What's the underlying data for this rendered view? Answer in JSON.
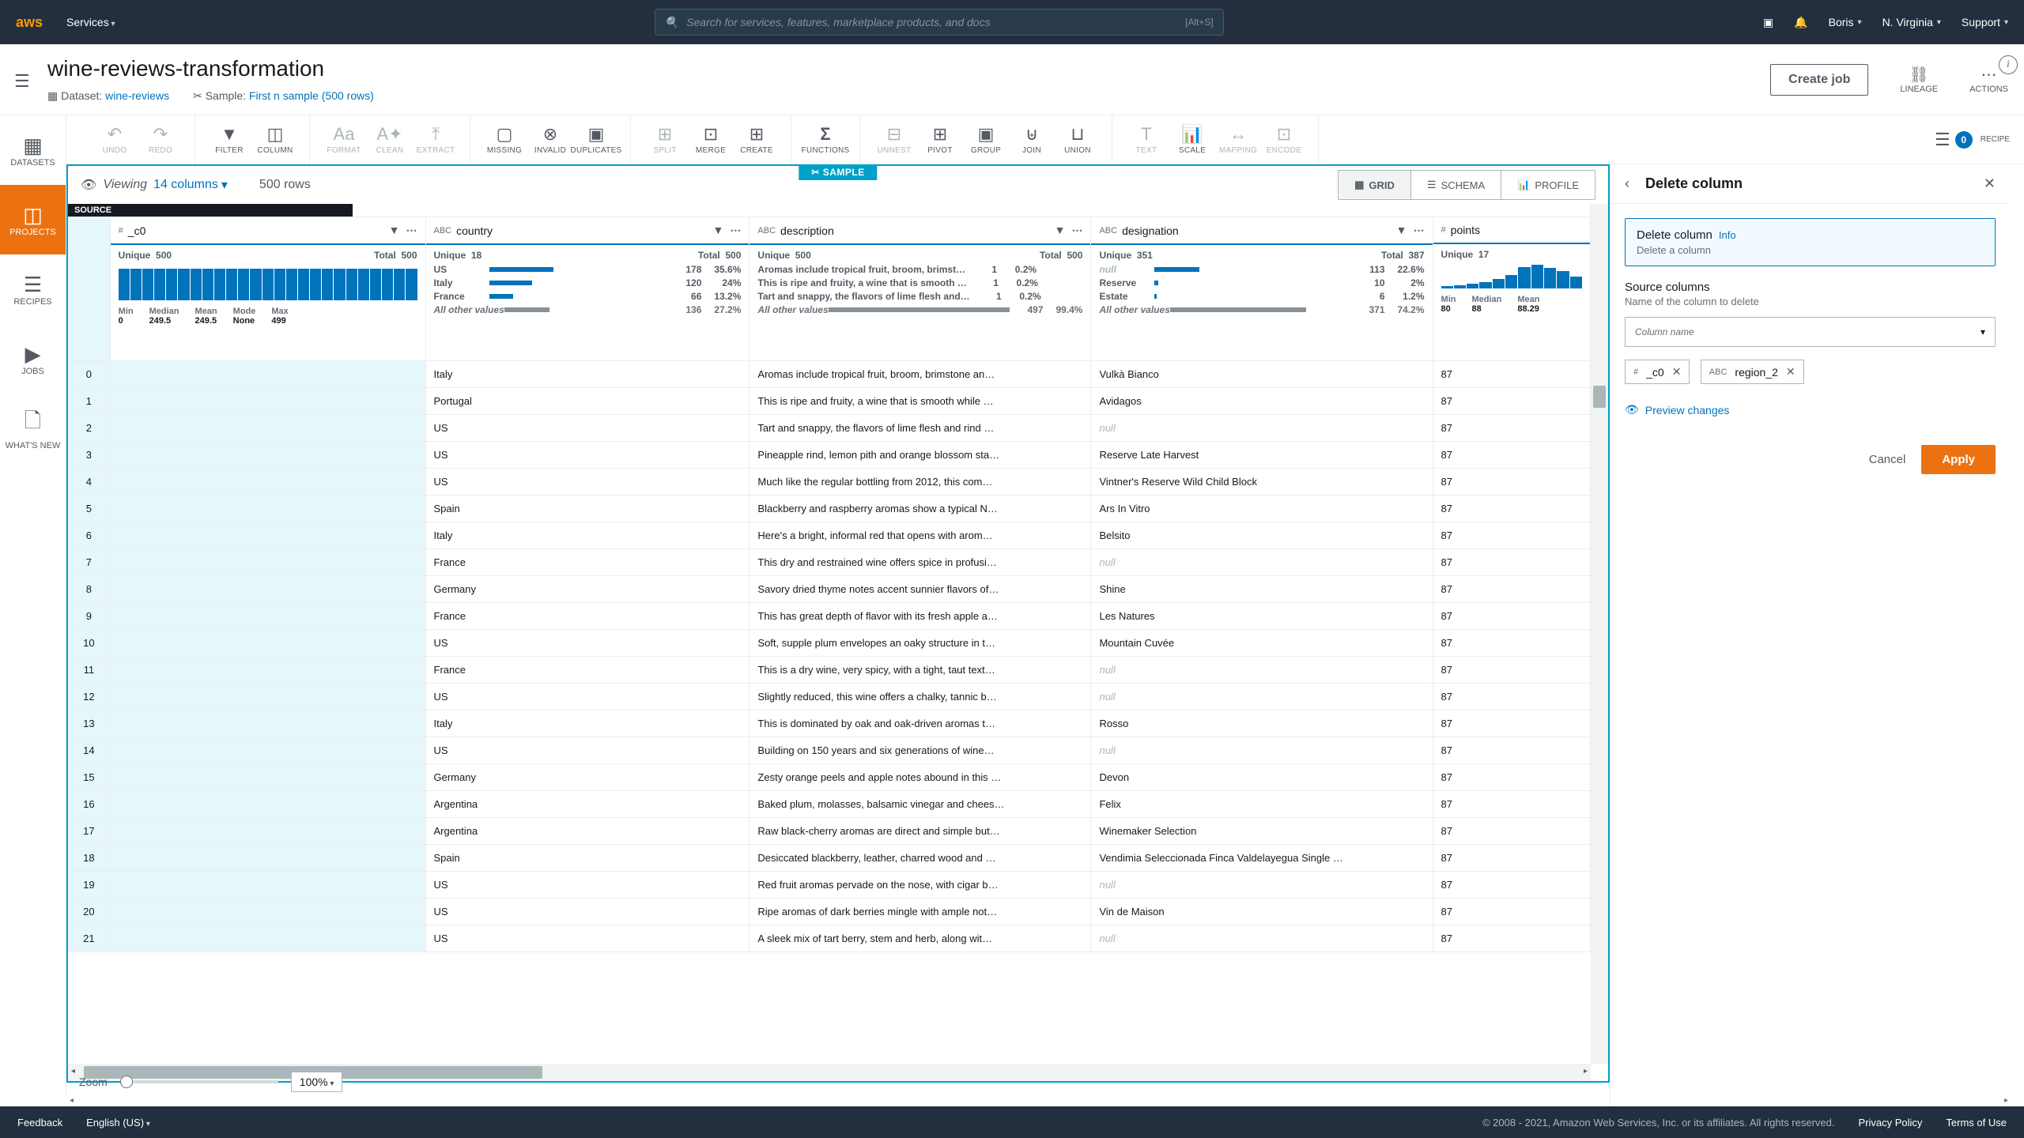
{
  "aws_bar": {
    "services": "Services",
    "search_placeholder": "Search for services, features, marketplace products, and docs",
    "search_kbd": "[Alt+S]",
    "user": "Boris",
    "region": "N. Virginia",
    "support": "Support"
  },
  "titlebar": {
    "title": "wine-reviews-transformation",
    "dataset_label": "Dataset:",
    "dataset_link": "wine-reviews",
    "sample_label": "Sample:",
    "sample_link": "First n sample (500 rows)",
    "create_job": "Create job",
    "lineage": "LINEAGE",
    "actions": "ACTIONS"
  },
  "sidebar": {
    "items": [
      "DATASETS",
      "PROJECTS",
      "RECIPES",
      "JOBS",
      "WHAT'S NEW"
    ]
  },
  "toolbar": {
    "undo": "UNDO",
    "redo": "REDO",
    "filter": "FILTER",
    "column": "COLUMN",
    "format": "FORMAT",
    "clean": "CLEAN",
    "extract": "EXTRACT",
    "missing": "MISSING",
    "invalid": "INVALID",
    "duplicates": "DUPLICATES",
    "split": "SPLIT",
    "merge": "MERGE",
    "create": "CREATE",
    "functions": "FUNCTIONS",
    "unnest": "UNNEST",
    "pivot": "PIVOT",
    "group": "GROUP",
    "join": "JOIN",
    "union": "UNION",
    "text": "TEXT",
    "scale": "SCALE",
    "mapping": "MAPPING",
    "encode": "ENCODE",
    "recipe": "RECIPE",
    "recipe_count": "0"
  },
  "view_header": {
    "viewing": "Viewing",
    "columns": "14 columns",
    "rows": "500 rows",
    "sample": "SAMPLE",
    "tab_grid": "GRID",
    "tab_schema": "SCHEMA",
    "tab_profile": "PROFILE"
  },
  "columns": {
    "idx_source": "SOURCE",
    "c0": {
      "type": "#",
      "name": "_c0",
      "unique_l": "Unique",
      "unique": "500",
      "total_l": "Total",
      "total": "500",
      "min_l": "Min",
      "min": "0",
      "median_l": "Median",
      "median": "249.5",
      "mean_l": "Mean",
      "mean": "249.5",
      "mode_l": "Mode",
      "mode": "None",
      "max_l": "Max",
      "max": "499"
    },
    "country": {
      "type": "ABC",
      "name": "country",
      "unique_l": "Unique",
      "unique": "18",
      "total_l": "Total",
      "total": "500",
      "d1": {
        "l": "US",
        "n": "178",
        "p": "35.6%"
      },
      "d2": {
        "l": "Italy",
        "n": "120",
        "p": "24%"
      },
      "d3": {
        "l": "France",
        "n": "66",
        "p": "13.2%"
      },
      "other": {
        "l": "All other values",
        "n": "136",
        "p": "27.2%"
      }
    },
    "description": {
      "type": "ABC",
      "name": "description",
      "unique_l": "Unique",
      "unique": "500",
      "total_l": "Total",
      "total": "500",
      "d1": {
        "l": "Aromas include tropical fruit, broom, brimst…",
        "n": "1",
        "p": "0.2%"
      },
      "d2": {
        "l": "This is ripe and fruity, a wine that is smooth …",
        "n": "1",
        "p": "0.2%"
      },
      "d3": {
        "l": "Tart and snappy, the flavors of lime flesh and…",
        "n": "1",
        "p": "0.2%"
      },
      "other": {
        "l": "All other values",
        "n": "497",
        "p": "99.4%"
      }
    },
    "designation": {
      "type": "ABC",
      "name": "designation",
      "unique_l": "Unique",
      "unique": "351",
      "total_l": "Total",
      "total": "387",
      "d1": {
        "l": "null",
        "n": "113",
        "p": "22.6%"
      },
      "d2": {
        "l": "Reserve",
        "n": "10",
        "p": "2%"
      },
      "d3": {
        "l": "Estate",
        "n": "6",
        "p": "1.2%"
      },
      "other": {
        "l": "All other values",
        "n": "371",
        "p": "74.2%"
      }
    },
    "points": {
      "type": "#",
      "name": "points",
      "unique_l": "Unique",
      "unique": "17",
      "min_l": "Min",
      "min": "80",
      "median_l": "Median",
      "median": "88",
      "mean_l": "Mean",
      "mean": "88.29"
    }
  },
  "rows": [
    {
      "i": "0",
      "country": "Italy",
      "desc": "Aromas include tropical fruit, broom, brimstone an…",
      "desig": "Vulkà Bianco",
      "pts": "87"
    },
    {
      "i": "1",
      "country": "Portugal",
      "desc": "This is ripe and fruity, a wine that is smooth while …",
      "desig": "Avidagos",
      "pts": "87"
    },
    {
      "i": "2",
      "country": "US",
      "desc": "Tart and snappy, the flavors of lime flesh and rind …",
      "desig": "null",
      "pts": "87"
    },
    {
      "i": "3",
      "country": "US",
      "desc": "Pineapple rind, lemon pith and orange blossom sta…",
      "desig": "Reserve Late Harvest",
      "pts": "87"
    },
    {
      "i": "4",
      "country": "US",
      "desc": "Much like the regular bottling from 2012, this com…",
      "desig": "Vintner's Reserve Wild Child Block",
      "pts": "87"
    },
    {
      "i": "5",
      "country": "Spain",
      "desc": "Blackberry and raspberry aromas show a typical N…",
      "desig": "Ars In Vitro",
      "pts": "87"
    },
    {
      "i": "6",
      "country": "Italy",
      "desc": "Here's a bright, informal red that opens with arom…",
      "desig": "Belsito",
      "pts": "87"
    },
    {
      "i": "7",
      "country": "France",
      "desc": "This dry and restrained wine offers spice in profusi…",
      "desig": "null",
      "pts": "87"
    },
    {
      "i": "8",
      "country": "Germany",
      "desc": "Savory dried thyme notes accent sunnier flavors of…",
      "desig": "Shine",
      "pts": "87"
    },
    {
      "i": "9",
      "country": "France",
      "desc": "This has great depth of flavor with its fresh apple a…",
      "desig": "Les Natures",
      "pts": "87"
    },
    {
      "i": "10",
      "country": "US",
      "desc": "Soft, supple plum envelopes an oaky structure in t…",
      "desig": "Mountain Cuvée",
      "pts": "87"
    },
    {
      "i": "11",
      "country": "France",
      "desc": "This is a dry wine, very spicy, with a tight, taut text…",
      "desig": "null",
      "pts": "87"
    },
    {
      "i": "12",
      "country": "US",
      "desc": "Slightly reduced, this wine offers a chalky, tannic b…",
      "desig": "null",
      "pts": "87"
    },
    {
      "i": "13",
      "country": "Italy",
      "desc": "This is dominated by oak and oak-driven aromas t…",
      "desig": "Rosso",
      "pts": "87"
    },
    {
      "i": "14",
      "country": "US",
      "desc": "Building on 150 years and six generations of wine…",
      "desig": "null",
      "pts": "87"
    },
    {
      "i": "15",
      "country": "Germany",
      "desc": "Zesty orange peels and apple notes abound in this …",
      "desig": "Devon",
      "pts": "87"
    },
    {
      "i": "16",
      "country": "Argentina",
      "desc": "Baked plum, molasses, balsamic vinegar and chees…",
      "desig": "Felix",
      "pts": "87"
    },
    {
      "i": "17",
      "country": "Argentina",
      "desc": "Raw black-cherry aromas are direct and simple but…",
      "desig": "Winemaker Selection",
      "pts": "87"
    },
    {
      "i": "18",
      "country": "Spain",
      "desc": "Desiccated blackberry, leather, charred wood and …",
      "desig": "Vendimia Seleccionada Finca Valdelayegua Single …",
      "pts": "87"
    },
    {
      "i": "19",
      "country": "US",
      "desc": "Red fruit aromas pervade on the nose, with cigar b…",
      "desig": "null",
      "pts": "87"
    },
    {
      "i": "20",
      "country": "US",
      "desc": "Ripe aromas of dark berries mingle with ample not…",
      "desig": "Vin de Maison",
      "pts": "87"
    },
    {
      "i": "21",
      "country": "US",
      "desc": "A sleek mix of tart berry, stem and herb, along wit…",
      "desig": "null",
      "pts": "87"
    }
  ],
  "panel": {
    "title": "Delete column",
    "box_title": "Delete column",
    "box_info": "Info",
    "box_desc": "Delete a column",
    "section_t": "Source columns",
    "section_d": "Name of the column to delete",
    "placeholder": "Column name",
    "chip1_type": "#",
    "chip1": "_c0",
    "chip2_type": "ABC",
    "chip2": "region_2",
    "preview": "Preview changes",
    "cancel": "Cancel",
    "apply": "Apply"
  },
  "zoom": {
    "label": "Zoom",
    "value": "100%"
  },
  "footer": {
    "feedback": "Feedback",
    "lang": "English (US)",
    "copy": "© 2008 - 2021, Amazon Web Services, Inc. or its affiliates. All rights reserved.",
    "privacy": "Privacy Policy",
    "terms": "Terms of Use"
  }
}
